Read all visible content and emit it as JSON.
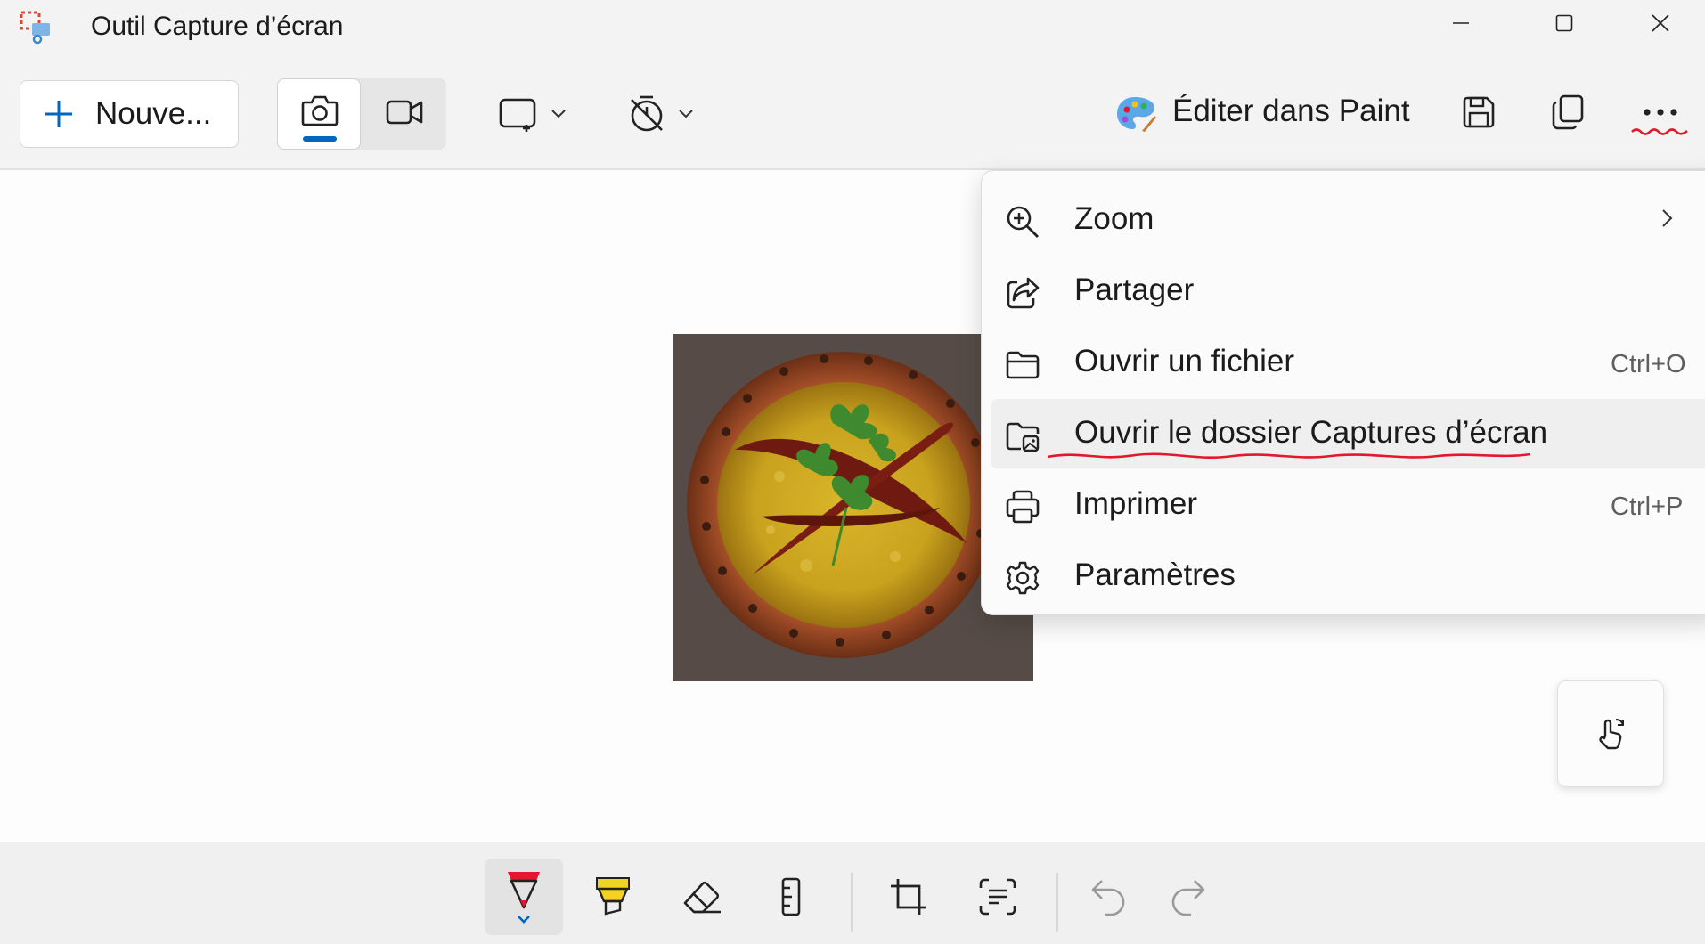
{
  "window": {
    "title": "Outil Capture d’écran",
    "icons": [
      "snipping-tool-icon",
      "minimize-icon",
      "maximize-icon",
      "close-icon"
    ]
  },
  "toolbar": {
    "new_label": "Nouve...",
    "mode_selected": "photo",
    "edit_in_paint_label": "Éditer dans Paint",
    "accent_color": "#0067c0",
    "icons": [
      "plus-icon",
      "camera-icon",
      "video-icon",
      "rectangle-snip-icon",
      "timer-off-icon",
      "paint-icon",
      "save-icon",
      "copy-icon",
      "more-icon"
    ]
  },
  "menu": {
    "items": [
      {
        "icon": "zoom-in-icon",
        "label": "Zoom",
        "submenu": true
      },
      {
        "icon": "share-icon",
        "label": "Partager"
      },
      {
        "icon": "folder-icon",
        "label": "Ouvrir un fichier",
        "shortcut": "Ctrl+O"
      },
      {
        "icon": "folder-image-icon",
        "label": "Ouvrir le dossier Captures d’écran",
        "highlighted": true
      },
      {
        "icon": "printer-icon",
        "label": "Imprimer",
        "shortcut": "Ctrl+P"
      },
      {
        "icon": "settings-icon",
        "label": "Paramètres"
      }
    ]
  },
  "annotations": {
    "underline_color": "#e3182d"
  },
  "bottom_tools": [
    {
      "icon": "pen-icon",
      "selected": true,
      "color": "#e3182d"
    },
    {
      "icon": "highlighter-icon",
      "color": "#f3d320"
    },
    {
      "icon": "eraser-icon"
    },
    {
      "icon": "ruler-icon"
    },
    {
      "icon": "crop-icon"
    },
    {
      "icon": "text-actions-icon"
    },
    {
      "icon": "undo-icon",
      "disabled": true
    },
    {
      "icon": "redo-icon",
      "disabled": true
    }
  ],
  "touch_button_icon": "touch-writing-icon"
}
